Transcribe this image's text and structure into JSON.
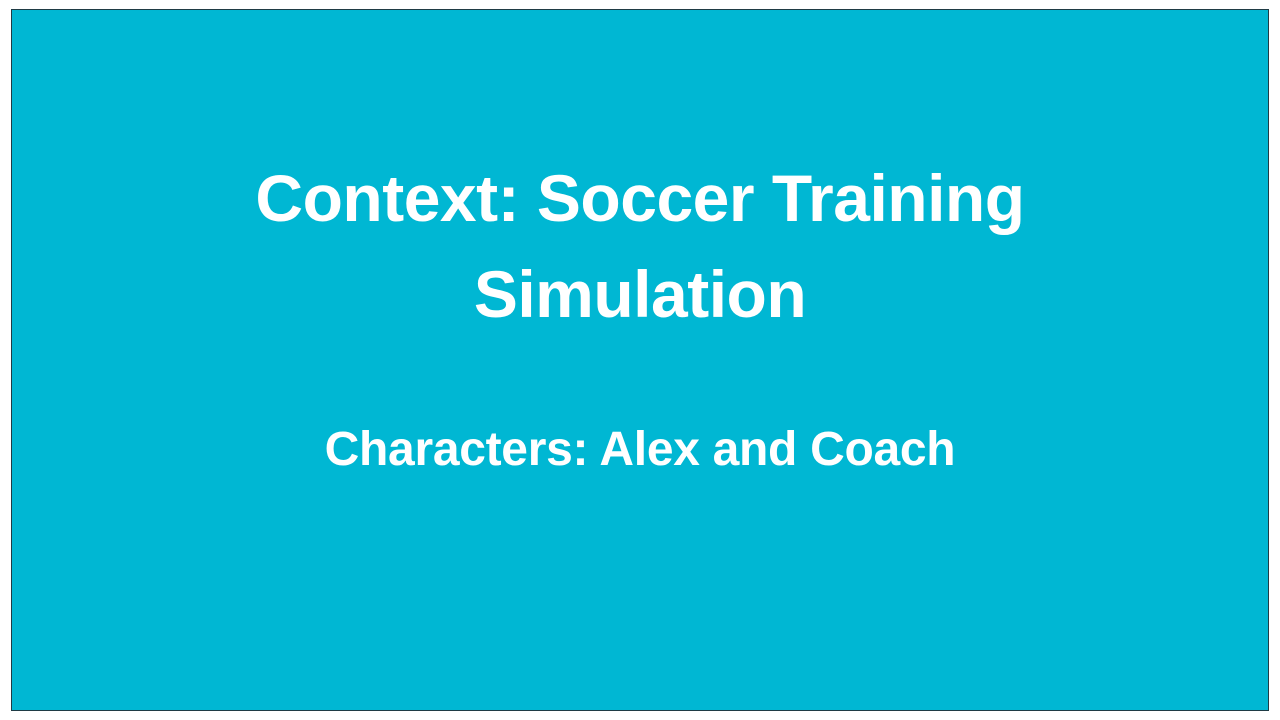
{
  "slide": {
    "background_color": "#00b7d3",
    "text_color": "#ffffff",
    "title_lines": [
      "Context: Soccer Training",
      "Simulation"
    ],
    "subtitle": "Characters: Alex and Coach"
  }
}
